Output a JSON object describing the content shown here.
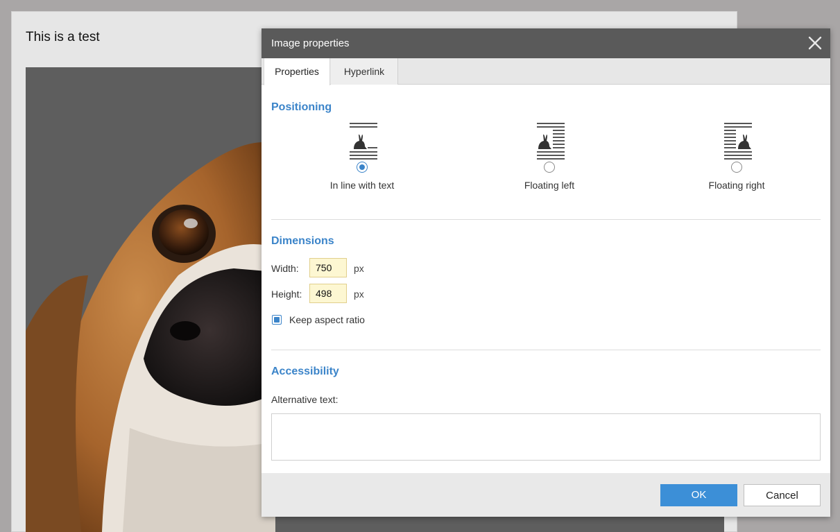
{
  "document": {
    "title": "This is a test"
  },
  "dialog": {
    "title": "Image properties",
    "close_icon": "close-icon",
    "tabs": [
      {
        "label": "Properties",
        "active": true
      },
      {
        "label": "Hyperlink",
        "active": false
      }
    ],
    "positioning": {
      "title": "Positioning",
      "options": [
        {
          "label": "In line with text",
          "icon": "inline-image-icon",
          "selected": true
        },
        {
          "label": "Floating left",
          "icon": "float-left-image-icon",
          "selected": false
        },
        {
          "label": "Floating right",
          "icon": "float-right-image-icon",
          "selected": false
        }
      ]
    },
    "dimensions": {
      "title": "Dimensions",
      "width_label": "Width:",
      "width_value": "750",
      "height_label": "Height:",
      "height_value": "498",
      "unit": "px",
      "keep_aspect_label": "Keep aspect ratio",
      "keep_aspect_checked": true
    },
    "accessibility": {
      "title": "Accessibility",
      "alt_label": "Alternative text:",
      "alt_value": ""
    },
    "footer": {
      "ok_label": "OK",
      "cancel_label": "Cancel"
    }
  },
  "colors": {
    "accent": "#3b84c9",
    "header": "#5a5a5a",
    "ok_button": "#3c8fd7",
    "input_bg": "#fdf7d2"
  }
}
